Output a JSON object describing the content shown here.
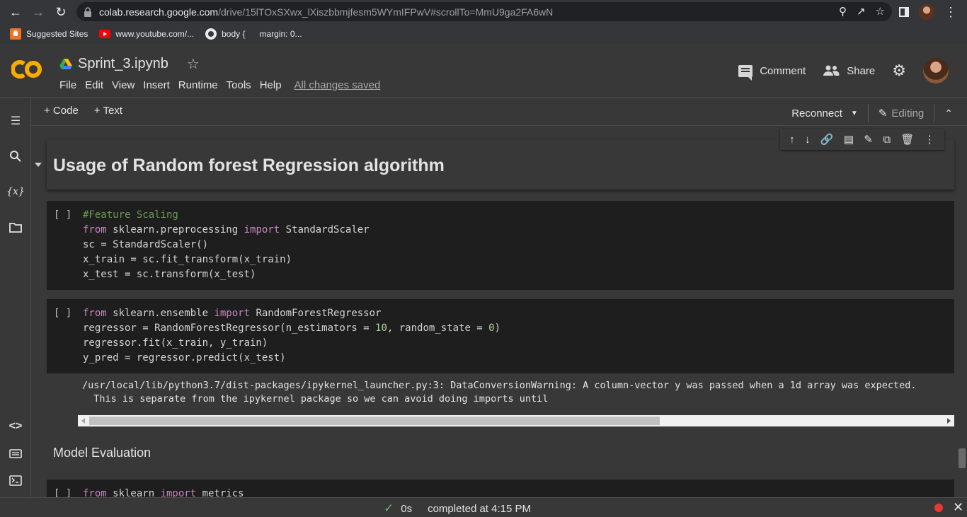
{
  "browser": {
    "url_host": "colab.research.google.com",
    "url_path": "/drive/15lTOxSXwx_lXiszbbmjfesm5WYmIFPwV#scrollTo=MmU9ga2FA6wN",
    "bookmarks": [
      "Suggested Sites",
      "www.youtube.com/...",
      "body {",
      "margin: 0..."
    ]
  },
  "colab": {
    "notebook_title": "Sprint_3.ipynb",
    "menu": [
      "File",
      "Edit",
      "View",
      "Insert",
      "Runtime",
      "Tools",
      "Help"
    ],
    "save_status": "All changes saved",
    "comment_label": "Comment",
    "share_label": "Share"
  },
  "toolbar": {
    "add_code": "+ Code",
    "add_text": "+ Text",
    "reconnect": "Reconnect",
    "editing": "Editing"
  },
  "cells": {
    "heading": "Usage of Random forest Regression algorithm",
    "run_label": "[ ]",
    "text_heading": "Model Evaluation",
    "output_line1": "/usr/local/lib/python3.7/dist-packages/ipykernel_launcher.py:3: DataConversionWarning: A column-vector y was passed when a 1d array was expected.",
    "output_line2": "  This is separate from the ipykernel package so we can avoid doing imports until"
  },
  "status": {
    "duration": "0s",
    "completed": "completed at 4:15 PM"
  },
  "colors": {
    "accent_orange": "#f9ab00",
    "success_green": "#5bb974",
    "recording_red": "#e53935"
  }
}
